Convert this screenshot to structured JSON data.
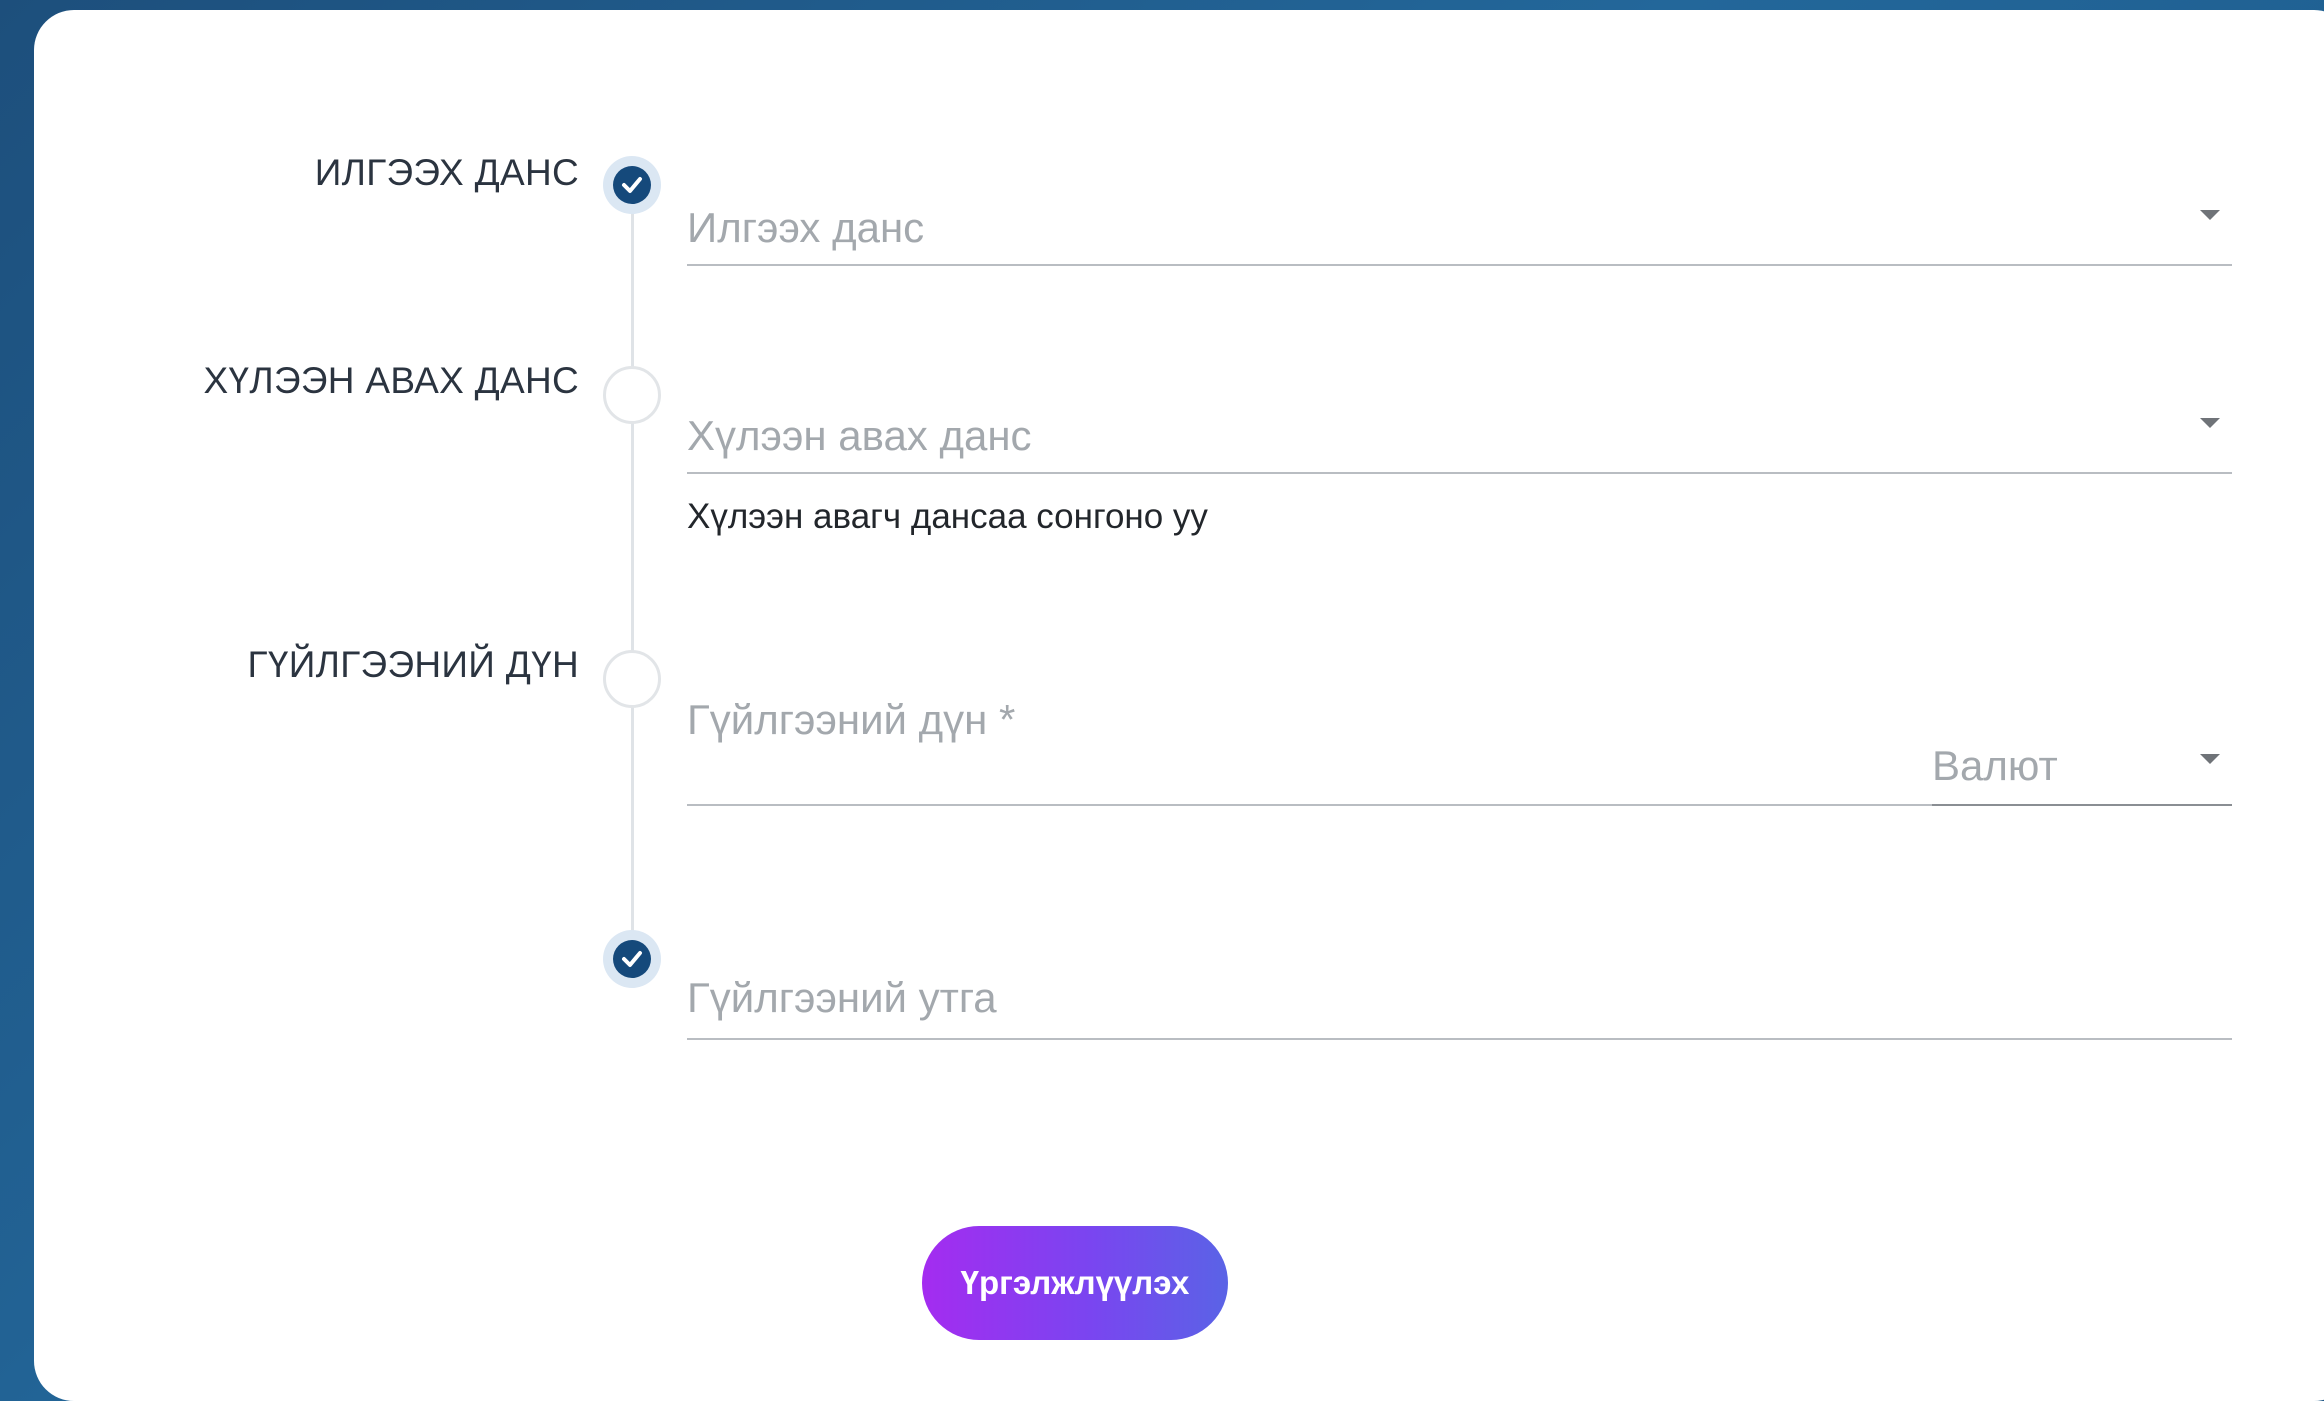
{
  "steps": [
    {
      "label": "ИЛГЭЭХ ДАНС",
      "status": "done"
    },
    {
      "label": "ХҮЛЭЭН АВАХ ДАНС",
      "status": "pending"
    },
    {
      "label": "ГҮЙЛГЭЭНИЙ ДҮН",
      "status": "pending"
    },
    {
      "label": "",
      "status": "done"
    }
  ],
  "form": {
    "from_account": {
      "placeholder": "Илгээх данс",
      "value": ""
    },
    "to_account": {
      "placeholder": "Хүлээн авах данс",
      "value": "",
      "helper": "Хүлээн авагч дансаа сонгоно уу"
    },
    "amount": {
      "placeholder": "Гүйлгээний дүн *",
      "value": ""
    },
    "currency": {
      "placeholder": "Валют",
      "value": ""
    },
    "description": {
      "placeholder": "Гүйлгээний утга",
      "value": ""
    }
  },
  "actions": {
    "continue_label": "Үргэлжлүүлэх"
  },
  "colors": {
    "accent_dark": "#15497b",
    "button_gradient_start": "#a42cf0",
    "button_gradient_end": "#5a63e6",
    "background": "#1f5a88"
  },
  "icons": {
    "step_done": "check-circle-icon",
    "select_caret": "caret-down-icon"
  }
}
